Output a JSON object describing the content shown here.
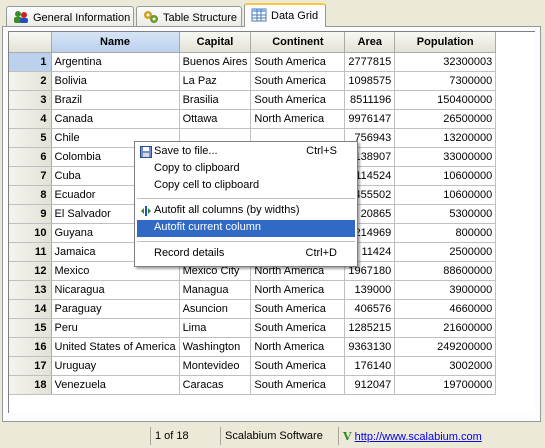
{
  "tabs": [
    {
      "label": "General Information",
      "icon": "db-users-icon",
      "active": false
    },
    {
      "label": "Table Structure",
      "icon": "structure-icon",
      "active": false
    },
    {
      "label": "Data Grid",
      "icon": "grid-icon",
      "active": true
    }
  ],
  "grid": {
    "columns": [
      "Name",
      "Capital",
      "Continent",
      "Area",
      "Population"
    ],
    "selected_column": "Name",
    "rows": [
      [
        "1",
        "Argentina",
        "Buenos Aires",
        "South America",
        "2777815",
        "32300003"
      ],
      [
        "2",
        "Bolivia",
        "La Paz",
        "South America",
        "1098575",
        "7300000"
      ],
      [
        "3",
        "Brazil",
        "Brasilia",
        "South America",
        "8511196",
        "150400000"
      ],
      [
        "4",
        "Canada",
        "Ottawa",
        "North America",
        "9976147",
        "26500000"
      ],
      [
        "5",
        "Chile",
        "",
        "",
        "756943",
        "13200000"
      ],
      [
        "6",
        "Colombia",
        "",
        "",
        "1138907",
        "33000000"
      ],
      [
        "7",
        "Cuba",
        "",
        "",
        "114524",
        "10600000"
      ],
      [
        "8",
        "Ecuador",
        "",
        "",
        "455502",
        "10600000"
      ],
      [
        "9",
        "El Salvador",
        "",
        "",
        "20865",
        "5300000"
      ],
      [
        "10",
        "Guyana",
        "",
        "",
        "214969",
        "800000"
      ],
      [
        "11",
        "Jamaica",
        "",
        "",
        "11424",
        "2500000"
      ],
      [
        "12",
        "Mexico",
        "Mexico City",
        "North America",
        "1967180",
        "88600000"
      ],
      [
        "13",
        "Nicaragua",
        "Managua",
        "North America",
        "139000",
        "3900000"
      ],
      [
        "14",
        "Paraguay",
        "Asuncion",
        "South America",
        "406576",
        "4660000"
      ],
      [
        "15",
        "Peru",
        "Lima",
        "South America",
        "1285215",
        "21600000"
      ],
      [
        "16",
        "United States of America",
        "Washington",
        "North America",
        "9363130",
        "249200000"
      ],
      [
        "17",
        "Uruguay",
        "Montevideo",
        "South America",
        "176140",
        "3002000"
      ],
      [
        "18",
        "Venezuela",
        "Caracas",
        "South America",
        "912047",
        "19700000"
      ]
    ]
  },
  "context_menu": {
    "items": [
      {
        "label": "Save to file...",
        "shortcut": "Ctrl+S",
        "icon": "save-icon"
      },
      {
        "label": "Copy to clipboard",
        "shortcut": ""
      },
      {
        "label": "Copy cell to clipboard",
        "shortcut": ""
      },
      {
        "label": "Autofit all columns (by widths)",
        "shortcut": "",
        "icon": "autofit-icon"
      },
      {
        "label": "Autofit current column",
        "shortcut": "",
        "highlighted": true
      },
      {
        "label": "Record details",
        "shortcut": "Ctrl+D"
      }
    ]
  },
  "status": {
    "record": "1 of 18",
    "company": "Scalabium Software",
    "url": "http://www.scalabium.com"
  },
  "colors": {
    "highlight": "#316ac5",
    "tab_accent": "#ffc83c",
    "link": "#0000ee"
  }
}
